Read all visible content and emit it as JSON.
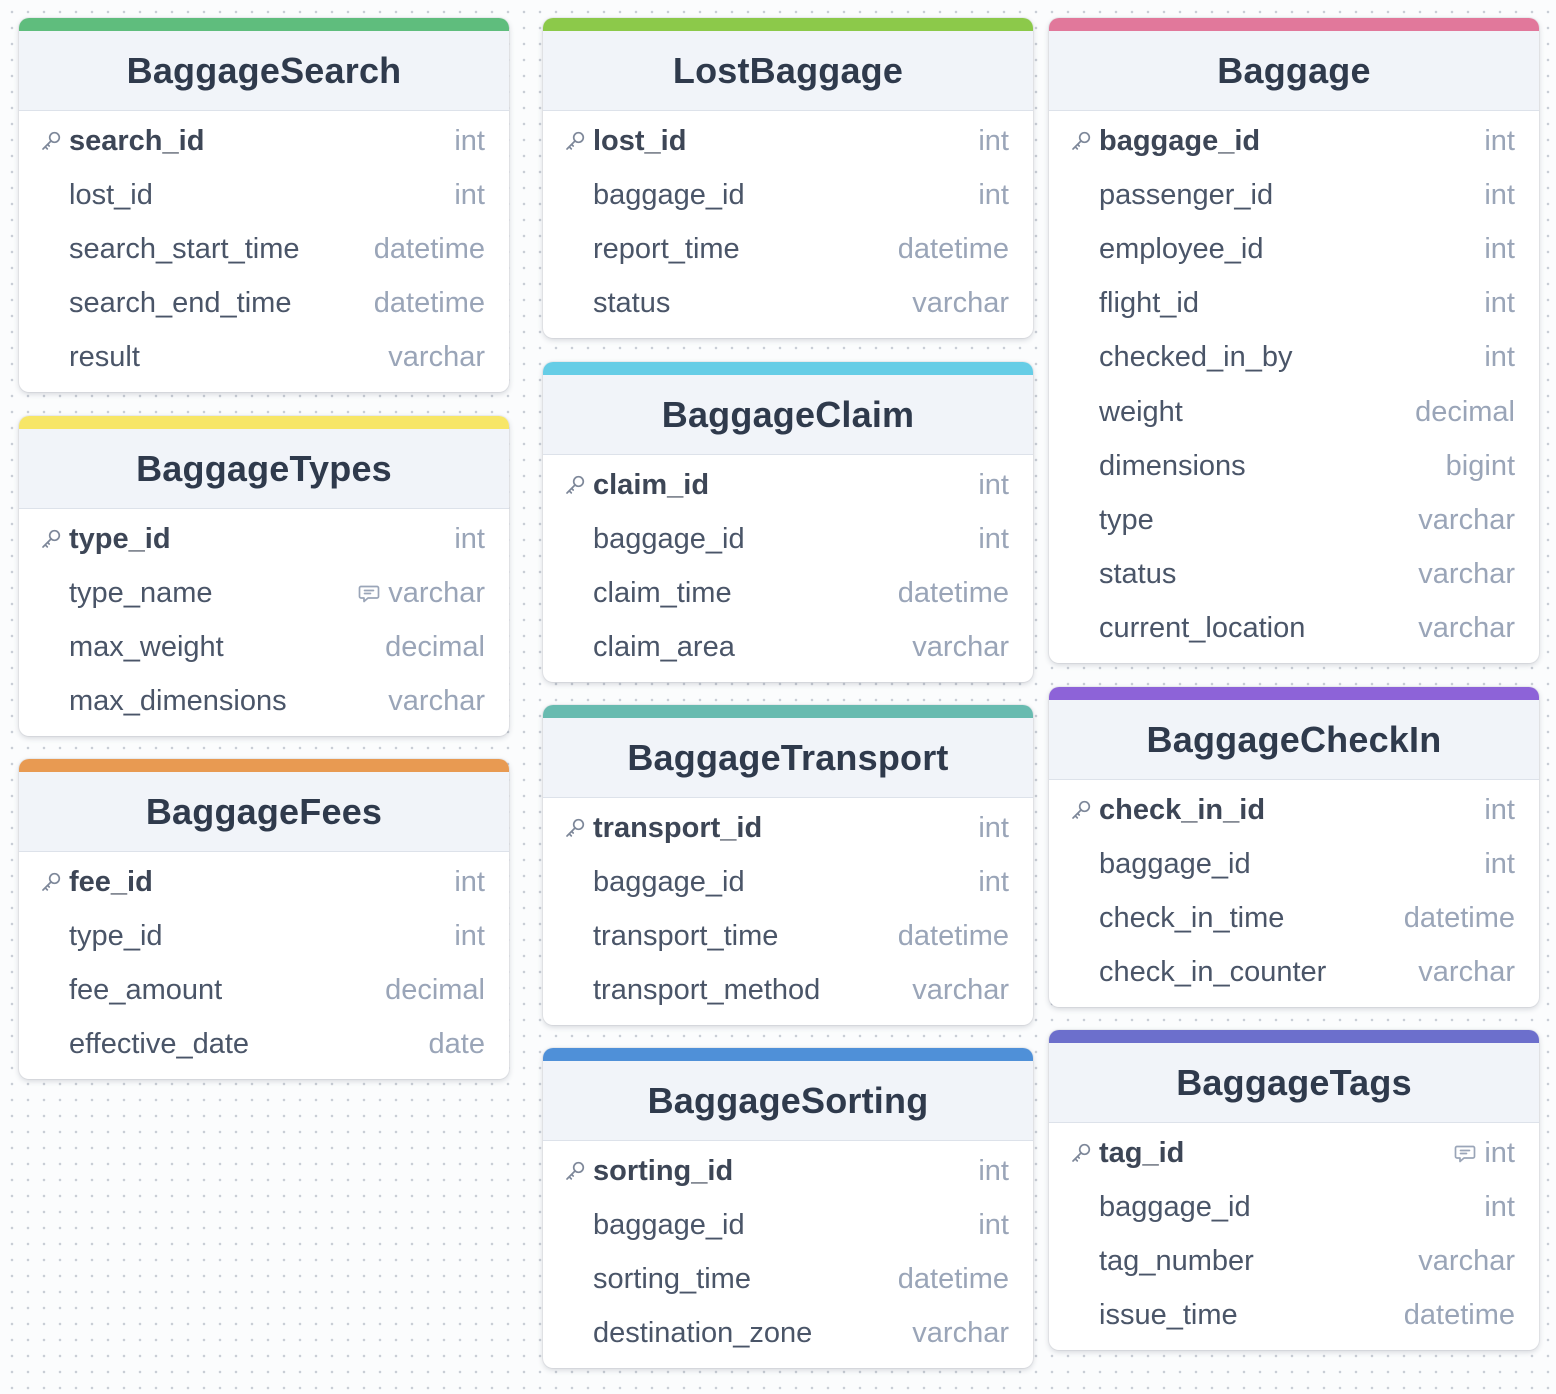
{
  "tables": [
    {
      "id": "BaggageSearch",
      "name": "BaggageSearch",
      "accent": "#5fbd7d",
      "fields": [
        {
          "name": "search_id",
          "type": "int",
          "pk": true
        },
        {
          "name": "lost_id",
          "type": "int"
        },
        {
          "name": "search_start_time",
          "type": "datetime"
        },
        {
          "name": "search_end_time",
          "type": "datetime"
        },
        {
          "name": "result",
          "type": "varchar"
        }
      ]
    },
    {
      "id": "LostBaggage",
      "name": "LostBaggage",
      "accent": "#8cc94a",
      "fields": [
        {
          "name": "lost_id",
          "type": "int",
          "pk": true
        },
        {
          "name": "baggage_id",
          "type": "int"
        },
        {
          "name": "report_time",
          "type": "datetime"
        },
        {
          "name": "status",
          "type": "varchar"
        }
      ]
    },
    {
      "id": "Baggage",
      "name": "Baggage",
      "accent": "#e1789b",
      "fields": [
        {
          "name": "baggage_id",
          "type": "int",
          "pk": true
        },
        {
          "name": "passenger_id",
          "type": "int"
        },
        {
          "name": "employee_id",
          "type": "int"
        },
        {
          "name": "flight_id",
          "type": "int"
        },
        {
          "name": "checked_in_by",
          "type": "int"
        },
        {
          "name": "weight",
          "type": "decimal"
        },
        {
          "name": "dimensions",
          "type": "bigint"
        },
        {
          "name": "type",
          "type": "varchar"
        },
        {
          "name": "status",
          "type": "varchar"
        },
        {
          "name": "current_location",
          "type": "varchar"
        }
      ]
    },
    {
      "id": "BaggageTypes",
      "name": "BaggageTypes",
      "accent": "#f7e667",
      "fields": [
        {
          "name": "type_id",
          "type": "int",
          "pk": true
        },
        {
          "name": "type_name",
          "type": "varchar",
          "note": true
        },
        {
          "name": "max_weight",
          "type": "decimal"
        },
        {
          "name": "max_dimensions",
          "type": "varchar"
        }
      ]
    },
    {
      "id": "BaggageClaim",
      "name": "BaggageClaim",
      "accent": "#66cde6",
      "fields": [
        {
          "name": "claim_id",
          "type": "int",
          "pk": true
        },
        {
          "name": "baggage_id",
          "type": "int"
        },
        {
          "name": "claim_time",
          "type": "datetime"
        },
        {
          "name": "claim_area",
          "type": "varchar"
        }
      ]
    },
    {
      "id": "BaggageFees",
      "name": "BaggageFees",
      "accent": "#e89a52",
      "fields": [
        {
          "name": "fee_id",
          "type": "int",
          "pk": true
        },
        {
          "name": "type_id",
          "type": "int"
        },
        {
          "name": "fee_amount",
          "type": "decimal"
        },
        {
          "name": "effective_date",
          "type": "date"
        }
      ]
    },
    {
      "id": "BaggageTransport",
      "name": "BaggageTransport",
      "accent": "#68bbb0",
      "fields": [
        {
          "name": "transport_id",
          "type": "int",
          "pk": true
        },
        {
          "name": "baggage_id",
          "type": "int"
        },
        {
          "name": "transport_time",
          "type": "datetime"
        },
        {
          "name": "transport_method",
          "type": "varchar"
        }
      ]
    },
    {
      "id": "BaggageCheckIn",
      "name": "BaggageCheckIn",
      "accent": "#8d63d8",
      "fields": [
        {
          "name": "check_in_id",
          "type": "int",
          "pk": true
        },
        {
          "name": "baggage_id",
          "type": "int"
        },
        {
          "name": "check_in_time",
          "type": "datetime"
        },
        {
          "name": "check_in_counter",
          "type": "varchar"
        }
      ]
    },
    {
      "id": "BaggageSorting",
      "name": "BaggageSorting",
      "accent": "#4f90d8",
      "fields": [
        {
          "name": "sorting_id",
          "type": "int",
          "pk": true
        },
        {
          "name": "baggage_id",
          "type": "int"
        },
        {
          "name": "sorting_time",
          "type": "datetime"
        },
        {
          "name": "destination_zone",
          "type": "varchar"
        }
      ]
    },
    {
      "id": "BaggageTags",
      "name": "BaggageTags",
      "accent": "#6c6fcc",
      "fields": [
        {
          "name": "tag_id",
          "type": "int",
          "pk": true,
          "note": true
        },
        {
          "name": "baggage_id",
          "type": "int"
        },
        {
          "name": "tag_number",
          "type": "varchar"
        },
        {
          "name": "issue_time",
          "type": "datetime"
        }
      ]
    }
  ]
}
